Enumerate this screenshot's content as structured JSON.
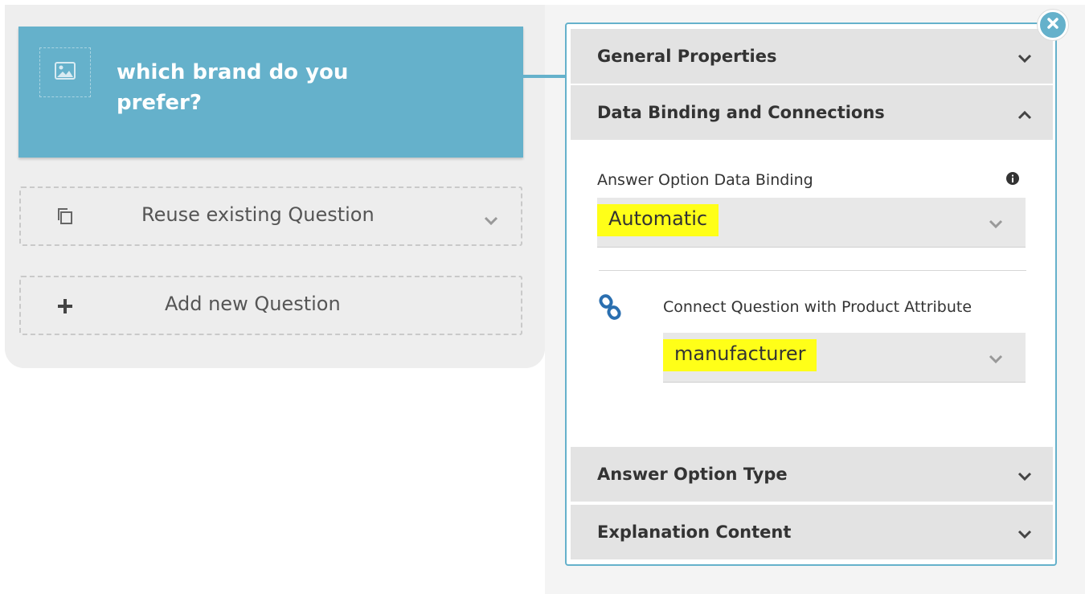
{
  "question": {
    "title": "which brand do you prefer?"
  },
  "left_actions": {
    "reuse_label": "Reuse existing Question",
    "add_label": "Add new Question"
  },
  "settings": {
    "sections": {
      "general": "General Properties",
      "binding": "Data Binding and Connections",
      "answer_type": "Answer Option Type",
      "explanation": "Explanation Content"
    },
    "binding_label": "Answer Option Data Binding",
    "binding_value": "Automatic",
    "connect_label": "Connect Question with Product Attribute",
    "connect_value": "manufacturer"
  },
  "colors": {
    "accent": "#65b1cb",
    "highlight": "#ffff18",
    "header_bg": "#e3e3e3"
  },
  "icons": {
    "image": "image-placeholder-icon",
    "copy": "copy-icon",
    "plus": "plus-icon",
    "chevron": "chevron-down-icon",
    "chevron_up": "chevron-up-icon",
    "info": "info-icon",
    "link": "link-icon",
    "close": "close-icon"
  }
}
